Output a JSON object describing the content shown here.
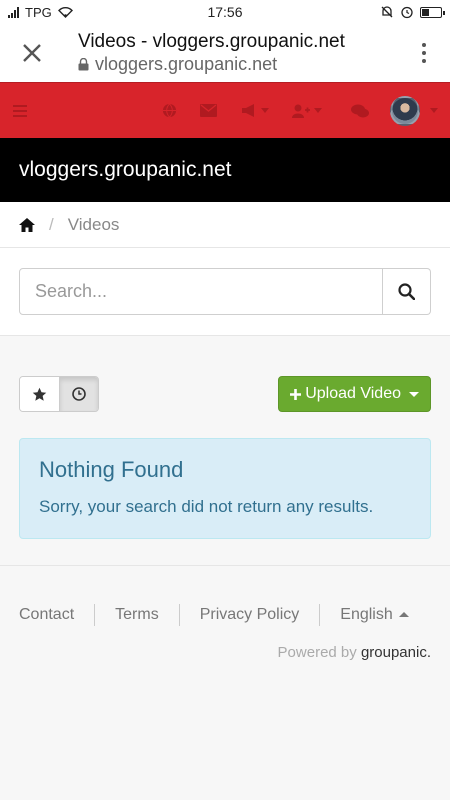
{
  "status_bar": {
    "carrier": "TPG",
    "time": "17:56"
  },
  "browser": {
    "page_title": "Videos - vloggers.groupanic.net",
    "url": "vloggers.groupanic.net"
  },
  "nav": {
    "icons": [
      "menu-icon",
      "globe-icon",
      "envelope-icon",
      "bullhorn-icon",
      "add-user-icon",
      "comments-icon"
    ],
    "accent_color": "#d8242b"
  },
  "site": {
    "title": "vloggers.groupanic.net"
  },
  "breadcrumb": {
    "current": "Videos"
  },
  "search": {
    "placeholder": "Search..."
  },
  "toolbar": {
    "upload_label": "Upload Video",
    "upload_color": "#6aaa2f"
  },
  "alert": {
    "heading": "Nothing Found",
    "message": "Sorry, your search did not return any results."
  },
  "footer": {
    "links": [
      "Contact",
      "Terms",
      "Privacy Policy"
    ],
    "language": "English",
    "powered_prefix": "Powered by ",
    "powered_brand": "groupanic."
  }
}
